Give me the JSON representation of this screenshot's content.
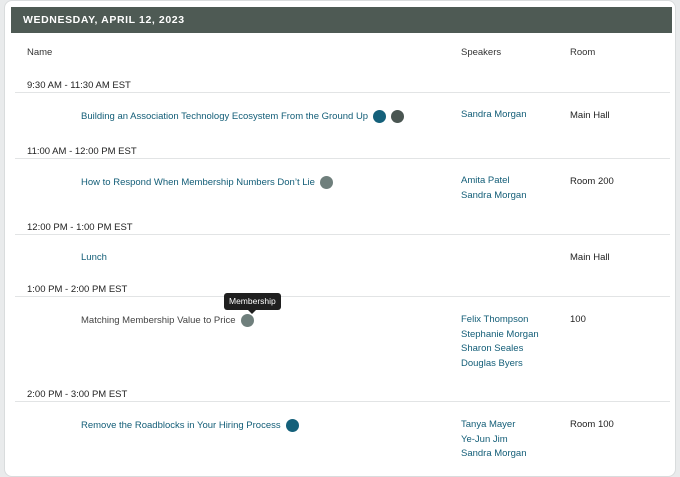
{
  "day": {
    "title": "WEDNESDAY, APRIL 12, 2023"
  },
  "columns": {
    "name": "Name",
    "speakers": "Speakers",
    "room": "Room"
  },
  "slots": [
    {
      "time": "9:30 AM - 11:30 AM EST",
      "title": "Building an Association Technology Ecosystem From the Ground Up",
      "tags": [
        "teal",
        "slate"
      ],
      "speakers": [
        "Sandra Morgan"
      ],
      "room": "Main Hall"
    },
    {
      "time": "11:00 AM - 12:00 PM EST",
      "title": "How to Respond When Membership Numbers Don’t Lie",
      "tags": [
        "grey"
      ],
      "speakers": [
        "Amita Patel",
        "Sandra Morgan"
      ],
      "room": "Room 200"
    },
    {
      "time": "12:00 PM - 1:00 PM EST",
      "title": "Lunch",
      "tags": [],
      "speakers": [],
      "room": "Main Hall"
    },
    {
      "time": "1:00 PM - 2:00 PM EST",
      "title": "Matching Membership Value to Price",
      "tags": [
        "grey"
      ],
      "speakers": [
        "Felix Thompson",
        "Stephanie Morgan",
        "Sharon Seales",
        "Douglas Byers"
      ],
      "room": "100"
    },
    {
      "time": "2:00 PM - 3:00 PM EST",
      "title": "Remove the Roadblocks in Your Hiring Process",
      "tags": [
        "teal"
      ],
      "speakers": [
        "Tanya Mayer",
        "Ye-Jun Jim",
        "Sandra Morgan"
      ],
      "room": "Room 100"
    }
  ],
  "tooltip": {
    "text": "Membership"
  },
  "colors": {
    "header_bg": "#4e5a54",
    "link": "#125d77",
    "tag_teal": "#14607a",
    "tag_slate": "#4a5652",
    "tag_grey": "#6f7f7c"
  }
}
